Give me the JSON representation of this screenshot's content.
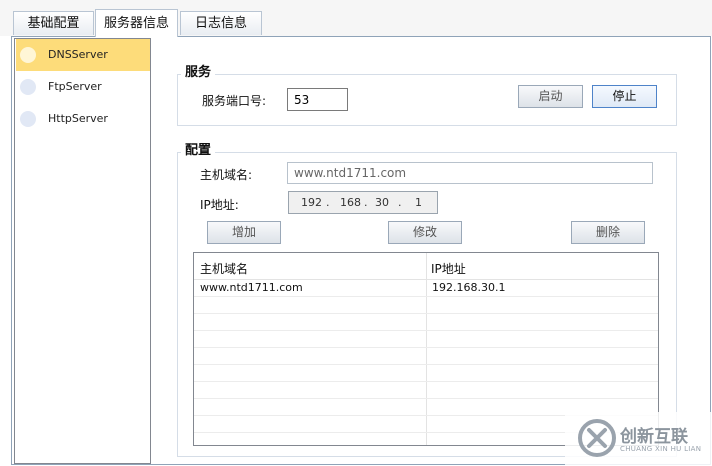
{
  "tabs": [
    {
      "label": "基础配置",
      "active": false
    },
    {
      "label": "服务器信息",
      "active": true
    },
    {
      "label": "日志信息",
      "active": false
    }
  ],
  "sidebar": {
    "items": [
      {
        "label": "DNSServer",
        "selected": true
      },
      {
        "label": "FtpServer",
        "selected": false
      },
      {
        "label": "HttpServer",
        "selected": false
      }
    ]
  },
  "service": {
    "title": "服务",
    "port_label": "服务端口号:",
    "port_value": "53",
    "start_label": "启动",
    "stop_label": "停止"
  },
  "config": {
    "title": "配置",
    "host_label": "主机域名:",
    "host_value": "www.ntd1711.com",
    "ip_label": "IP地址:",
    "ip_octets": [
      "192",
      "168",
      "30",
      "1"
    ],
    "ip_dot": ".",
    "add_label": "增加",
    "edit_label": "修改",
    "delete_label": "删除"
  },
  "table": {
    "columns": [
      "主机域名",
      "IP地址"
    ],
    "rows": [
      [
        "www.ntd1711.com",
        "192.168.30.1"
      ]
    ]
  },
  "watermark": {
    "brand": "创新互联",
    "sub": "CHUANG XIN HU LIAN"
  },
  "colors": {
    "selected_bg": "#fddc7a",
    "primary_border": "#4e83c9"
  }
}
